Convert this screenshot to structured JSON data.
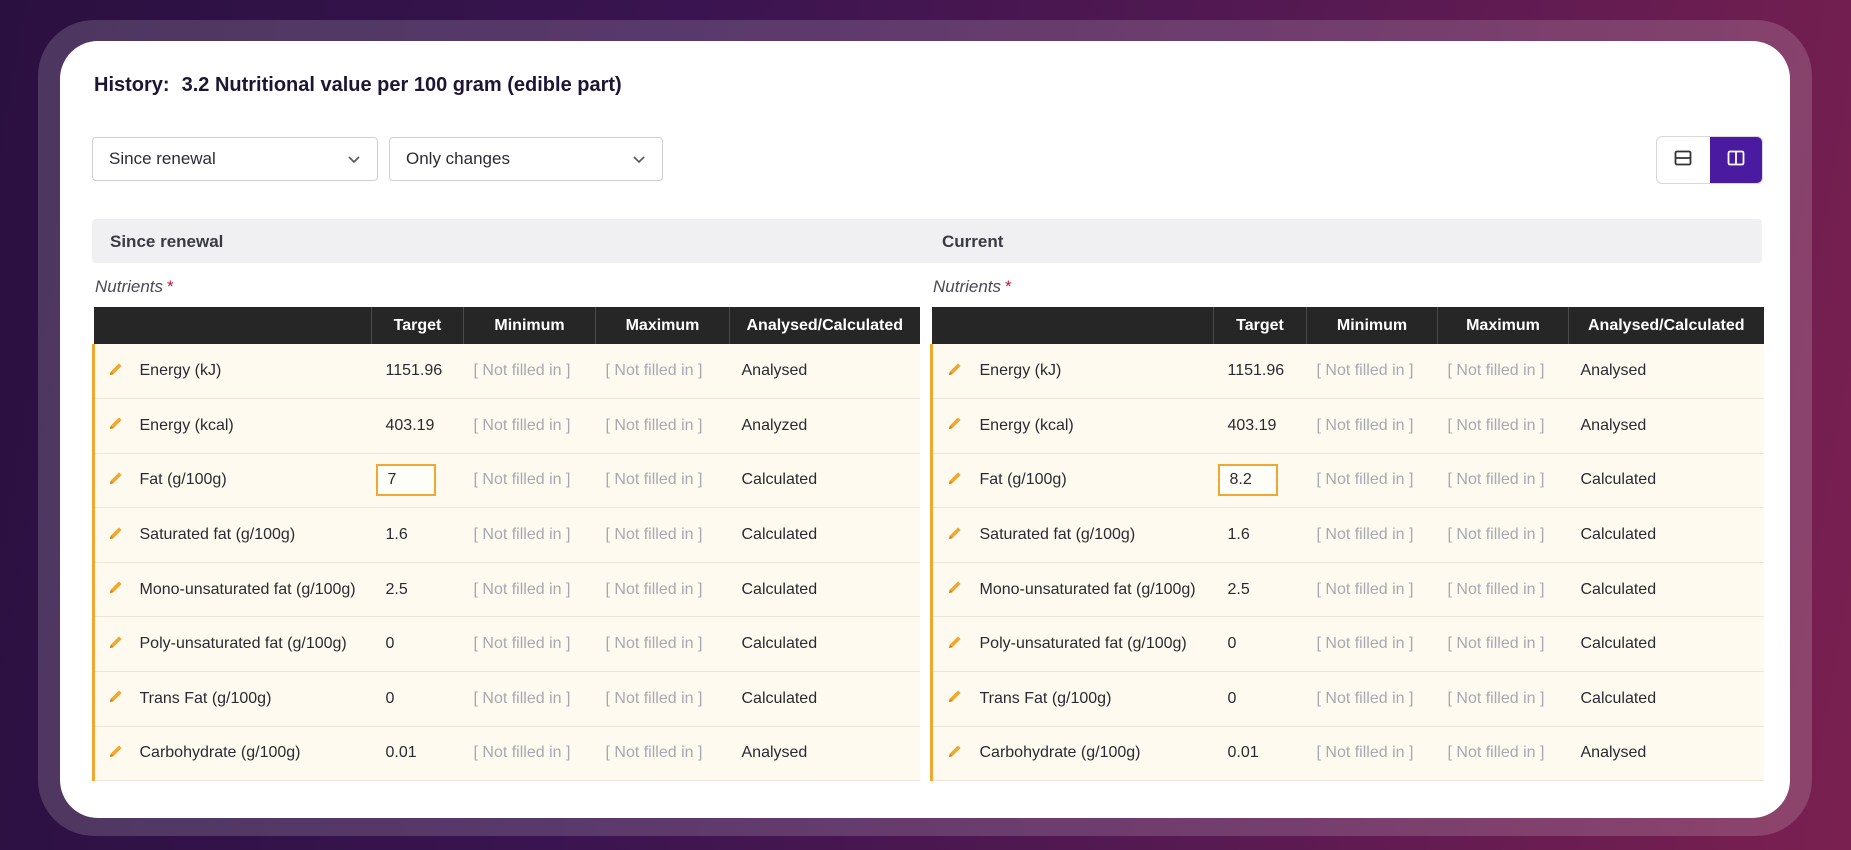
{
  "header": {
    "history_label": "History:",
    "title": "3.2 Nutritional value per 100 gram (edible part)"
  },
  "filters": {
    "period": "Since renewal",
    "mode": "Only changes"
  },
  "view_toggle": {
    "active": "side-by-side"
  },
  "columns": {
    "target": "Target",
    "minimum": "Minimum",
    "maximum": "Maximum",
    "analysed": "Analysed/Calculated"
  },
  "left_panel": {
    "title": "Since renewal",
    "nutrients_label": "Nutrients",
    "required_mark": "*",
    "rows": [
      {
        "name": "Energy (kJ)",
        "target": "1151.96",
        "min": "[ Not filled in ]",
        "max": "[ Not filled in ]",
        "analysed": "Analysed",
        "changed": false
      },
      {
        "name": "Energy (kcal)",
        "target": "403.19",
        "min": "[ Not filled in ]",
        "max": "[ Not filled in ]",
        "analysed": "Analyzed",
        "changed": false
      },
      {
        "name": "Fat (g/100g)",
        "target": "7",
        "min": "[ Not filled in ]",
        "max": "[ Not filled in ]",
        "analysed": "Calculated",
        "changed": true
      },
      {
        "name": "Saturated fat (g/100g)",
        "target": "1.6",
        "min": "[ Not filled in ]",
        "max": "[ Not filled in ]",
        "analysed": "Calculated",
        "changed": false
      },
      {
        "name": "Mono-unsaturated fat (g/100g)",
        "target": "2.5",
        "min": "[ Not filled in ]",
        "max": "[ Not filled in ]",
        "analysed": "Calculated",
        "changed": false
      },
      {
        "name": "Poly-unsaturated fat (g/100g)",
        "target": "0",
        "min": "[ Not filled in ]",
        "max": "[ Not filled in ]",
        "analysed": "Calculated",
        "changed": false
      },
      {
        "name": "Trans Fat (g/100g)",
        "target": "0",
        "min": "[ Not filled in ]",
        "max": "[ Not filled in ]",
        "analysed": "Calculated",
        "changed": false
      },
      {
        "name": "Carbohydrate (g/100g)",
        "target": "0.01",
        "min": "[ Not filled in ]",
        "max": "[ Not filled in ]",
        "analysed": "Analysed",
        "changed": false
      }
    ]
  },
  "right_panel": {
    "title": "Current",
    "nutrients_label": "Nutrients",
    "required_mark": "*",
    "rows": [
      {
        "name": "Energy (kJ)",
        "target": "1151.96",
        "min": "[ Not filled in ]",
        "max": "[ Not filled in ]",
        "analysed": "Analysed",
        "changed": false
      },
      {
        "name": "Energy (kcal)",
        "target": "403.19",
        "min": "[ Not filled in ]",
        "max": "[ Not filled in ]",
        "analysed": "Analysed",
        "changed": false
      },
      {
        "name": "Fat (g/100g)",
        "target": "8.2",
        "min": "[ Not filled in ]",
        "max": "[ Not filled in ]",
        "analysed": "Calculated",
        "changed": true
      },
      {
        "name": "Saturated fat (g/100g)",
        "target": "1.6",
        "min": "[ Not filled in ]",
        "max": "[ Not filled in ]",
        "analysed": "Calculated",
        "changed": false
      },
      {
        "name": "Mono-unsaturated fat (g/100g)",
        "target": "2.5",
        "min": "[ Not filled in ]",
        "max": "[ Not filled in ]",
        "analysed": "Calculated",
        "changed": false
      },
      {
        "name": "Poly-unsaturated fat (g/100g)",
        "target": "0",
        "min": "[ Not filled in ]",
        "max": "[ Not filled in ]",
        "analysed": "Calculated",
        "changed": false
      },
      {
        "name": "Trans Fat (g/100g)",
        "target": "0",
        "min": "[ Not filled in ]",
        "max": "[ Not filled in ]",
        "analysed": "Calculated",
        "changed": false
      },
      {
        "name": "Carbohydrate (g/100g)",
        "target": "0.01",
        "min": "[ Not filled in ]",
        "max": "[ Not filled in ]",
        "analysed": "Analysed",
        "changed": false
      }
    ]
  },
  "colors": {
    "accent": "#4a1aa0",
    "edit_icon": "#f0a830",
    "required": "#c8102e"
  }
}
